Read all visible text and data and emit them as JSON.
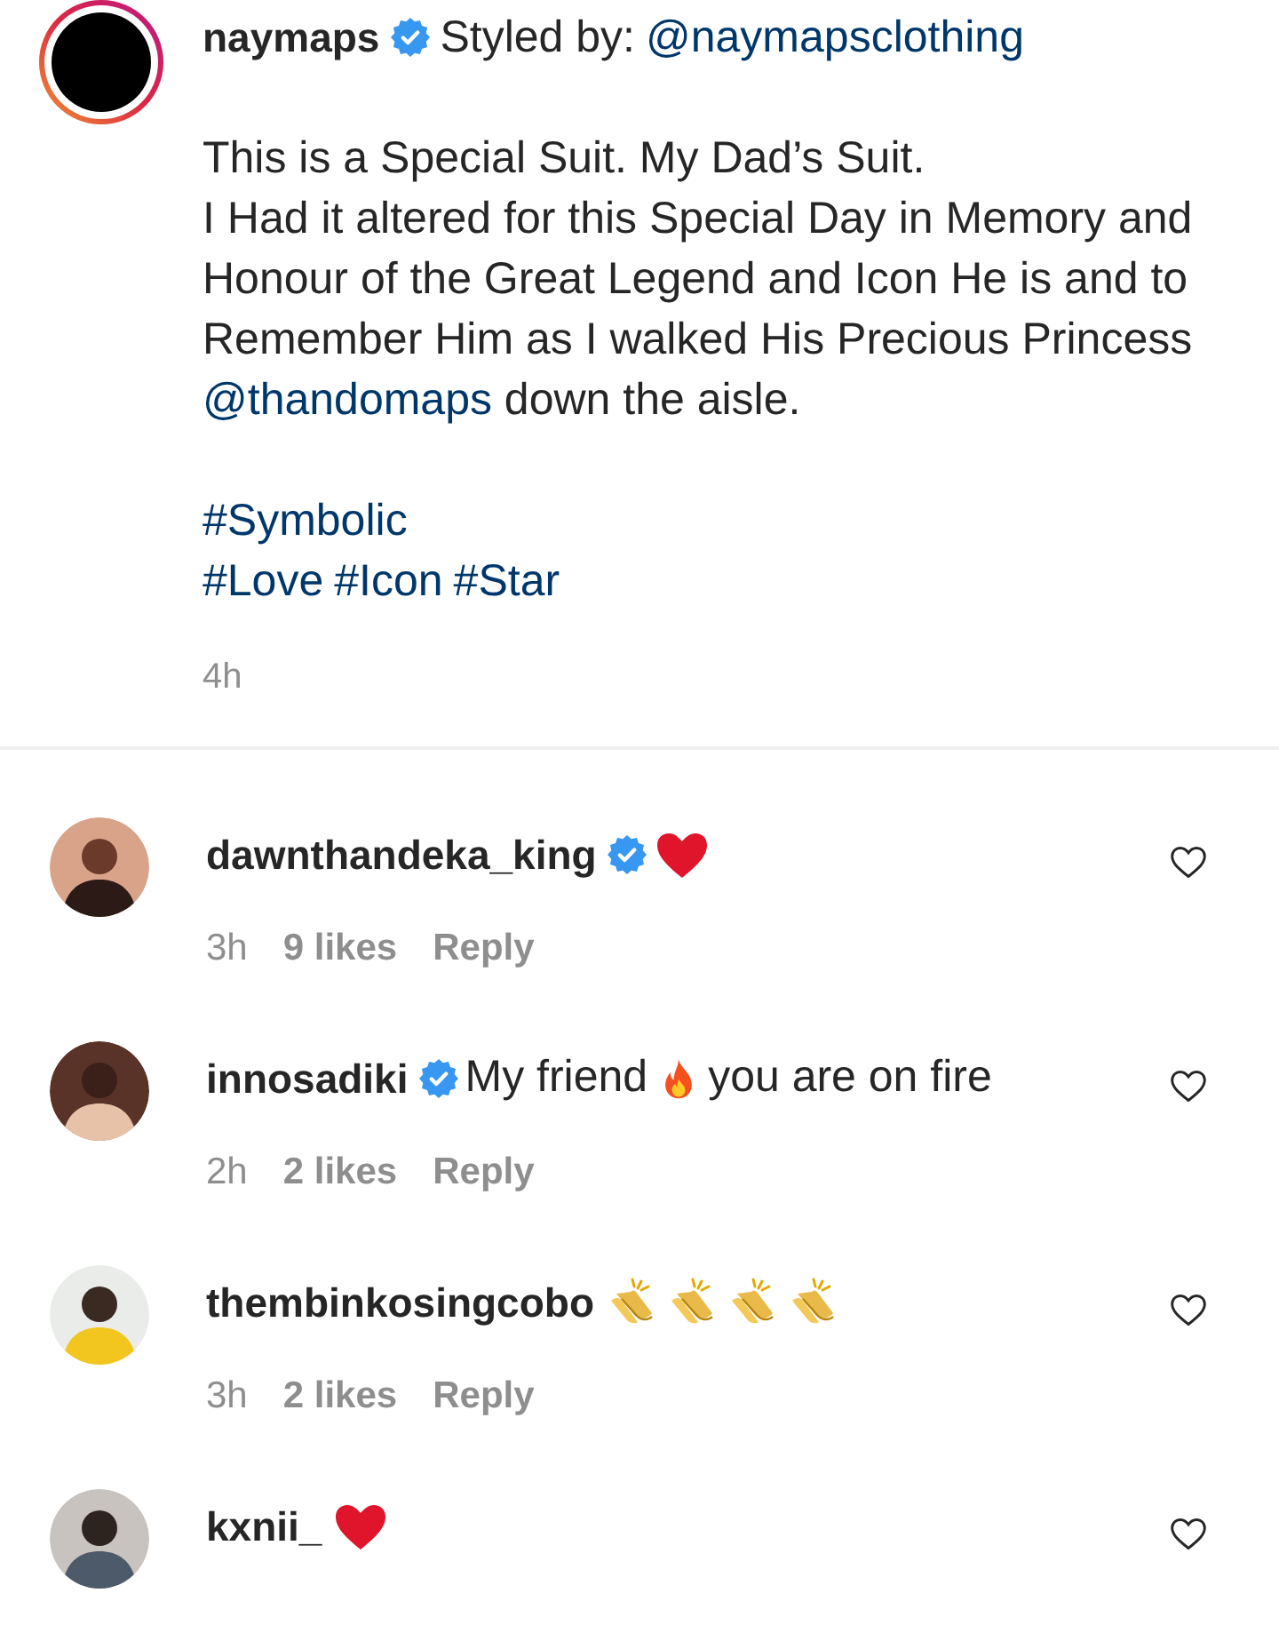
{
  "post": {
    "story_ring": true,
    "username": "naymaps",
    "verified": true,
    "header_text": "Styled by:",
    "header_link": "@naymapsclothing",
    "caption": [
      [
        {
          "kind": "text",
          "text": "This is a Special Suit. My Dad’s Suit."
        }
      ],
      [
        {
          "kind": "text",
          "text": "I Had it altered for this Special Day in Memory and Honour of the Great Legend and Icon He is and to Remember Him as I walked His Precious Princess "
        },
        {
          "kind": "link",
          "text": "@thandomaps"
        },
        {
          "kind": "text",
          "text": " down the aisle."
        }
      ]
    ],
    "hashtag_lines": [
      [
        "#Symbolic"
      ],
      [
        "#Love",
        "#Icon",
        "#Star"
      ]
    ],
    "time": "4h"
  },
  "comments": [
    {
      "username": "dawnthandeka_king",
      "verified": true,
      "body": [
        {
          "kind": "heart-emoji"
        }
      ],
      "time": "3h",
      "likes": "9 likes",
      "reply": "Reply",
      "liked": false
    },
    {
      "username": "innosadiki",
      "verified": true,
      "body": [
        {
          "kind": "text",
          "text": "My friend"
        },
        {
          "kind": "fire-emoji"
        },
        {
          "kind": "text",
          "text": "you are on fire"
        }
      ],
      "time": "2h",
      "likes": "2 likes",
      "reply": "Reply",
      "liked": false
    },
    {
      "username": "thembinkosingcobo",
      "verified": false,
      "body": [
        {
          "kind": "clap-emoji"
        },
        {
          "kind": "clap-emoji"
        },
        {
          "kind": "clap-emoji"
        },
        {
          "kind": "clap-emoji"
        }
      ],
      "time": "3h",
      "likes": "2 likes",
      "reply": "Reply",
      "liked": false
    },
    {
      "username": "kxnii_",
      "verified": false,
      "body": [
        {
          "kind": "heart-emoji"
        }
      ],
      "liked": false
    }
  ]
}
